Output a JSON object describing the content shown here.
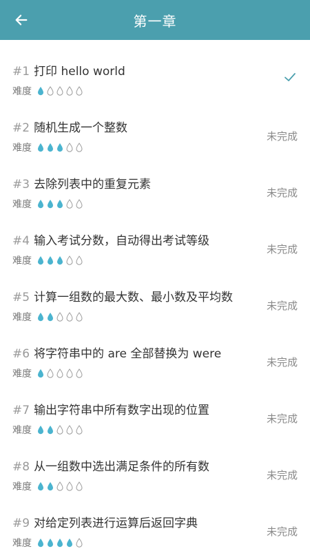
{
  "header": {
    "title": "第一章"
  },
  "difficulty_label": "难度",
  "colors": {
    "header_bg": "#4b9fae",
    "drop_filled": "#4bb4cf",
    "drop_empty_stroke": "#9a9a9a",
    "check": "#4b9fae"
  },
  "icons": {
    "back": "arrow-left-icon",
    "done": "check-icon",
    "difficulty": "drop-icon"
  },
  "max_difficulty": 5,
  "items": [
    {
      "num": "#1",
      "title": "打印 hello world",
      "difficulty": 1,
      "status": "",
      "done": true
    },
    {
      "num": "#2",
      "title": "随机生成一个整数",
      "difficulty": 3,
      "status": "未完成",
      "done": false
    },
    {
      "num": "#3",
      "title": "去除列表中的重复元素",
      "difficulty": 3,
      "status": "未完成",
      "done": false
    },
    {
      "num": "#4",
      "title": "输入考试分数，自动得出考试等级",
      "difficulty": 3,
      "status": "未完成",
      "done": false
    },
    {
      "num": "#5",
      "title": "计算一组数的最大数、最小数及平均数",
      "difficulty": 2,
      "status": "未完成",
      "done": false
    },
    {
      "num": "#6",
      "title": "将字符串中的 are 全部替换为 were",
      "difficulty": 1,
      "status": "未完成",
      "done": false
    },
    {
      "num": "#7",
      "title": "输出字符串中所有数字出现的位置",
      "difficulty": 2,
      "status": "未完成",
      "done": false
    },
    {
      "num": "#8",
      "title": "从一组数中选出满足条件的所有数",
      "difficulty": 2,
      "status": "未完成",
      "done": false
    },
    {
      "num": "#9",
      "title": "对给定列表进行运算后返回字典",
      "difficulty": 4,
      "status": "未完成",
      "done": false
    }
  ]
}
